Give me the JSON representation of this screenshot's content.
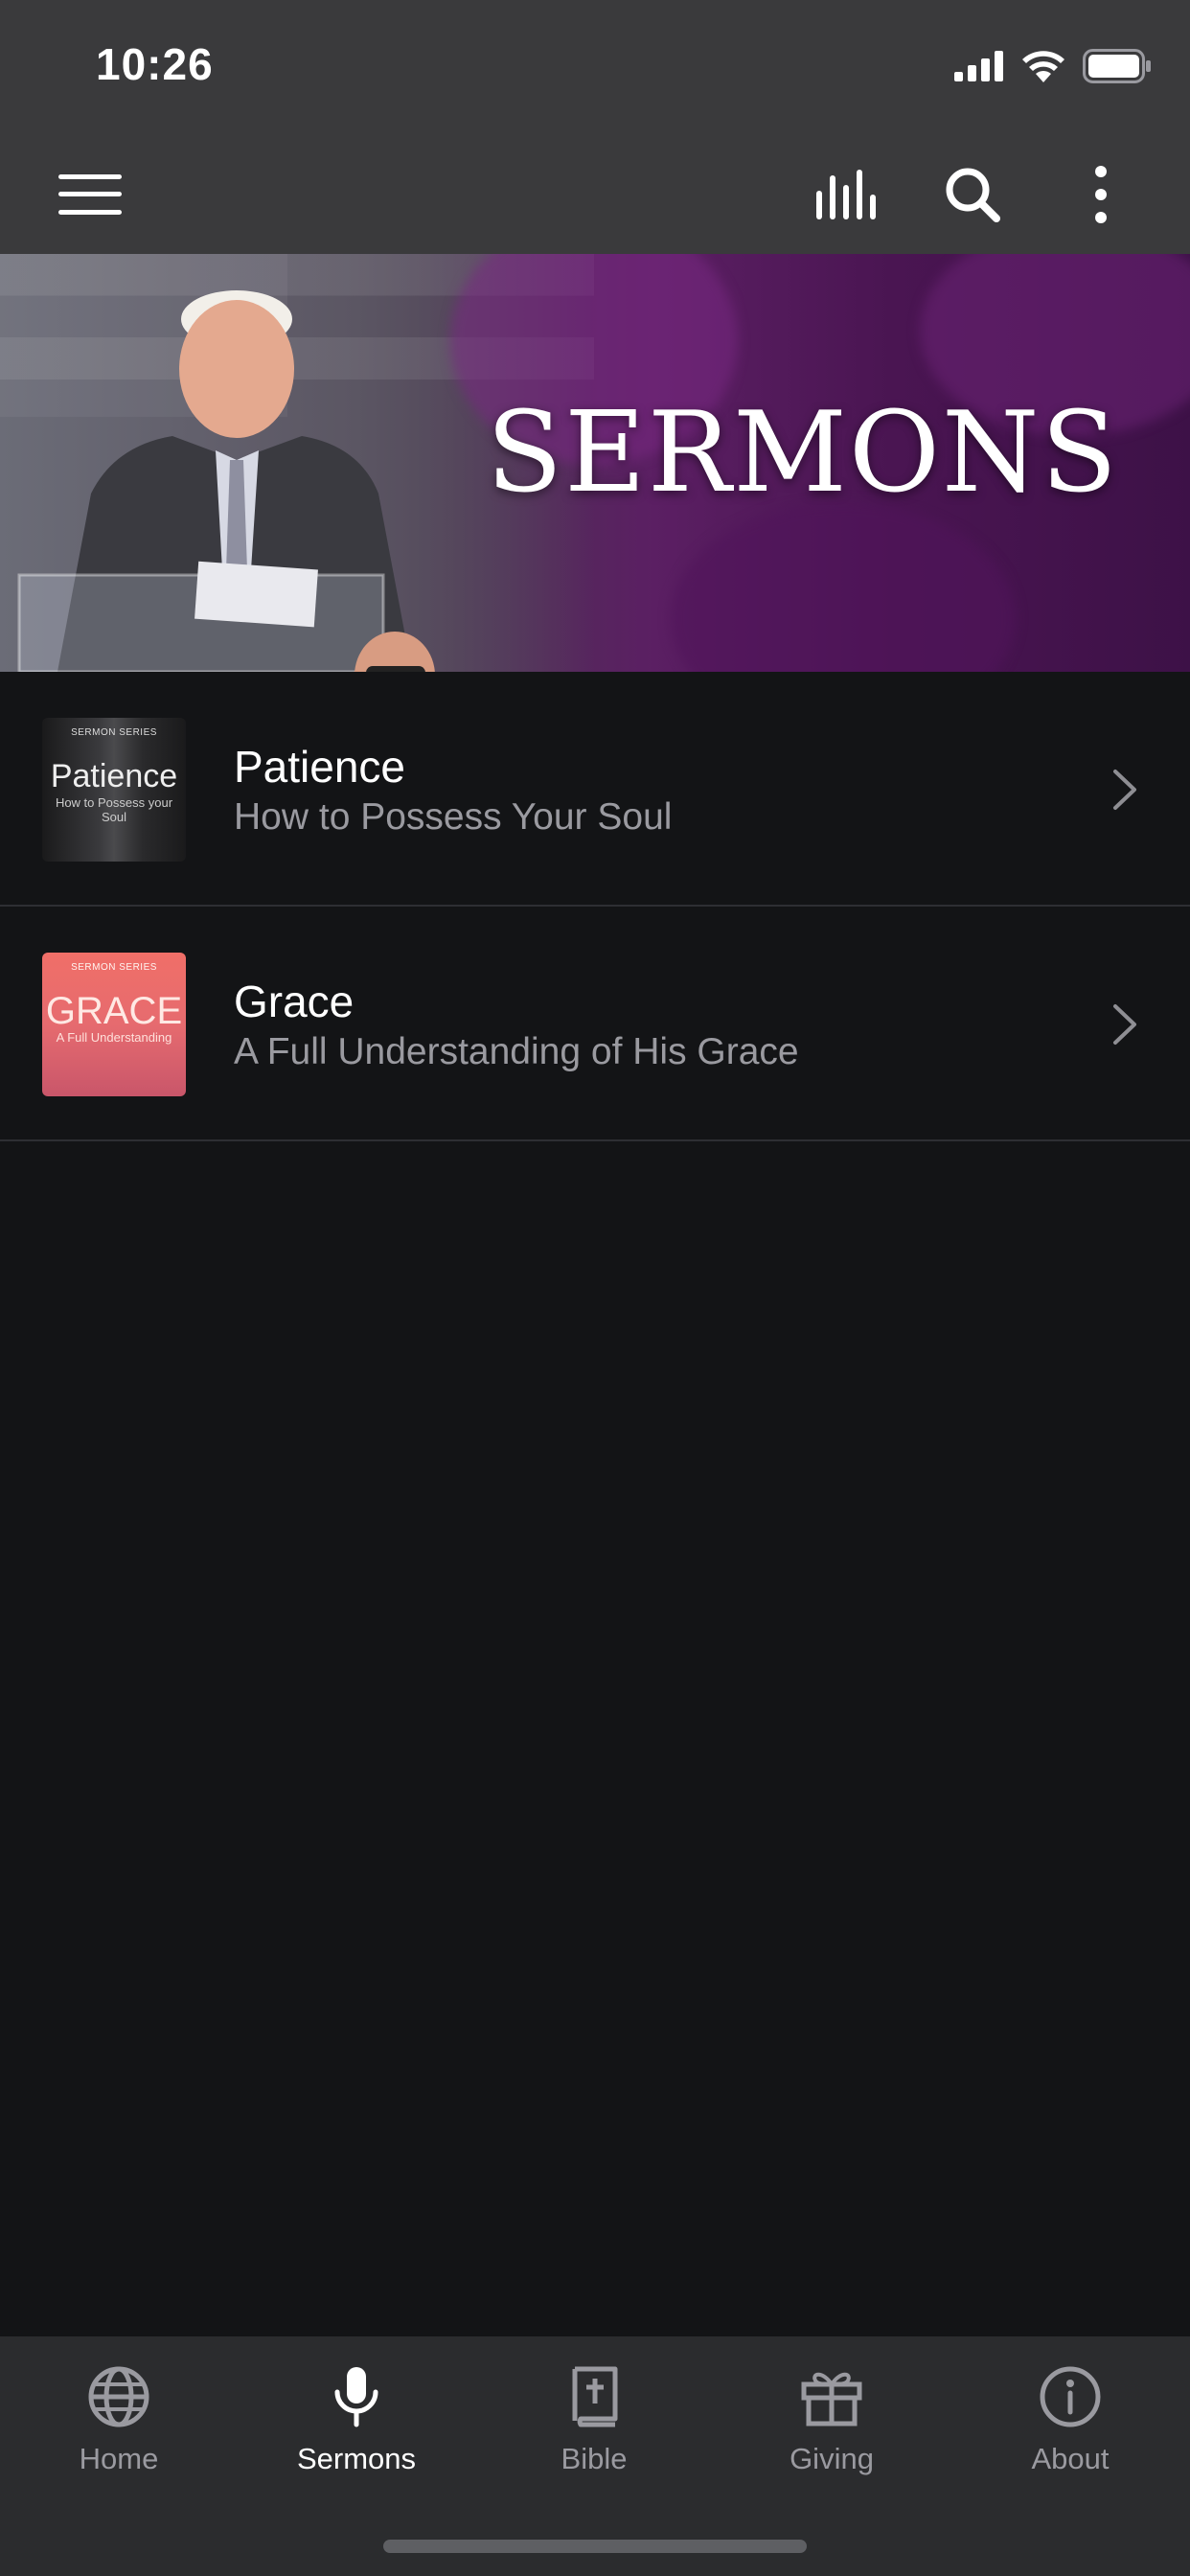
{
  "status_bar": {
    "time": "10:26"
  },
  "app_bar": {
    "icons": [
      "menu-icon",
      "audio-bars-icon",
      "search-icon",
      "more-vertical-icon"
    ]
  },
  "hero": {
    "title": "SERMONS"
  },
  "series": [
    {
      "title": "Patience",
      "subtitle": "How to Possess Your Soul",
      "thumbnail": {
        "label": "SERMON SERIES",
        "title": "Patience",
        "subtitle": "How to Possess your Soul"
      }
    },
    {
      "title": "Grace",
      "subtitle": "A Full Understanding of His Grace",
      "thumbnail": {
        "label": "SERMON SERIES",
        "title": "GRACE",
        "subtitle": "A Full Understanding"
      }
    }
  ],
  "tabs": [
    {
      "label": "Home",
      "icon": "globe-icon"
    },
    {
      "label": "Sermons",
      "icon": "microphone-icon"
    },
    {
      "label": "Bible",
      "icon": "bible-icon"
    },
    {
      "label": "Giving",
      "icon": "gift-icon"
    },
    {
      "label": "About",
      "icon": "info-icon"
    }
  ],
  "active_tab": "Sermons",
  "colors": {
    "background": "#131416",
    "bar": "#3a3a3c",
    "tab_bar": "#2b2c2e",
    "muted_text": "#9a9aa0",
    "hero_purple": "#5b1f63"
  }
}
